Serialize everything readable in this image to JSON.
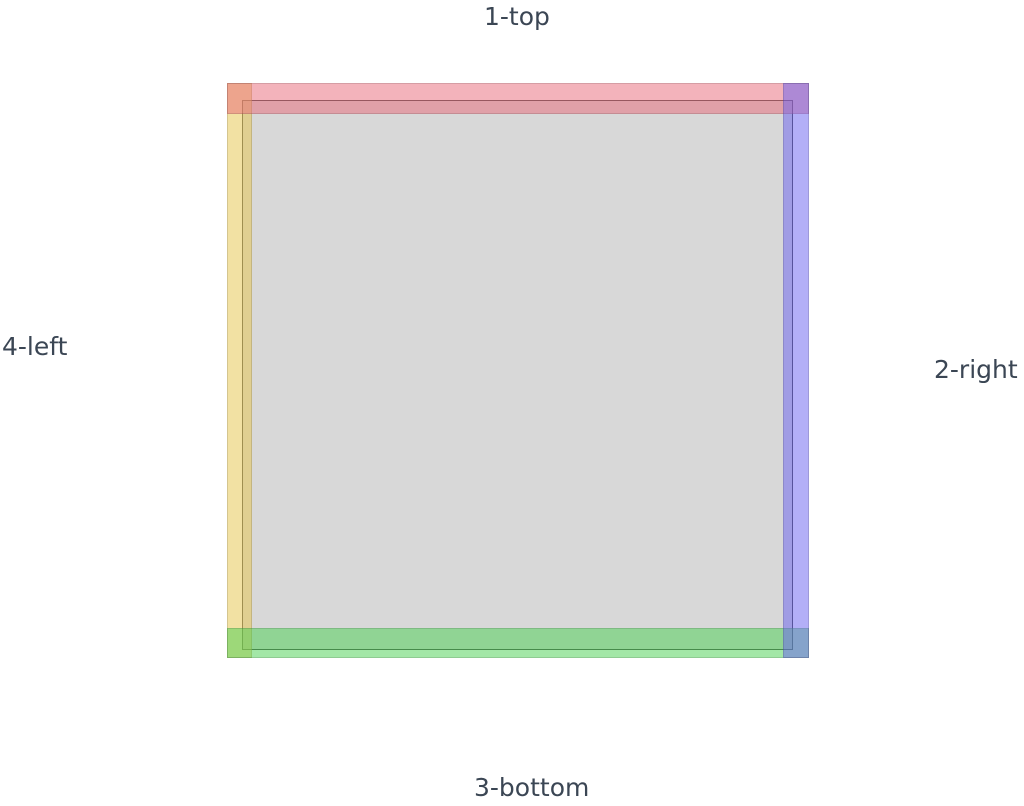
{
  "labels": {
    "top": "1-top",
    "right": "2-right",
    "bottom": "3-bottom",
    "left": "4-left"
  },
  "colors": {
    "inner_fill": "#d8d8d8",
    "inner_border": "#474747",
    "top_edge": "rgba(232, 104, 120, 0.50)",
    "right_edge": "rgba(104, 96, 240, 0.50)",
    "bottom_edge": "rgba(72, 208, 80, 0.50)",
    "left_edge": "rgba(232, 200, 88, 0.55)",
    "label_text": "#3b4654"
  }
}
